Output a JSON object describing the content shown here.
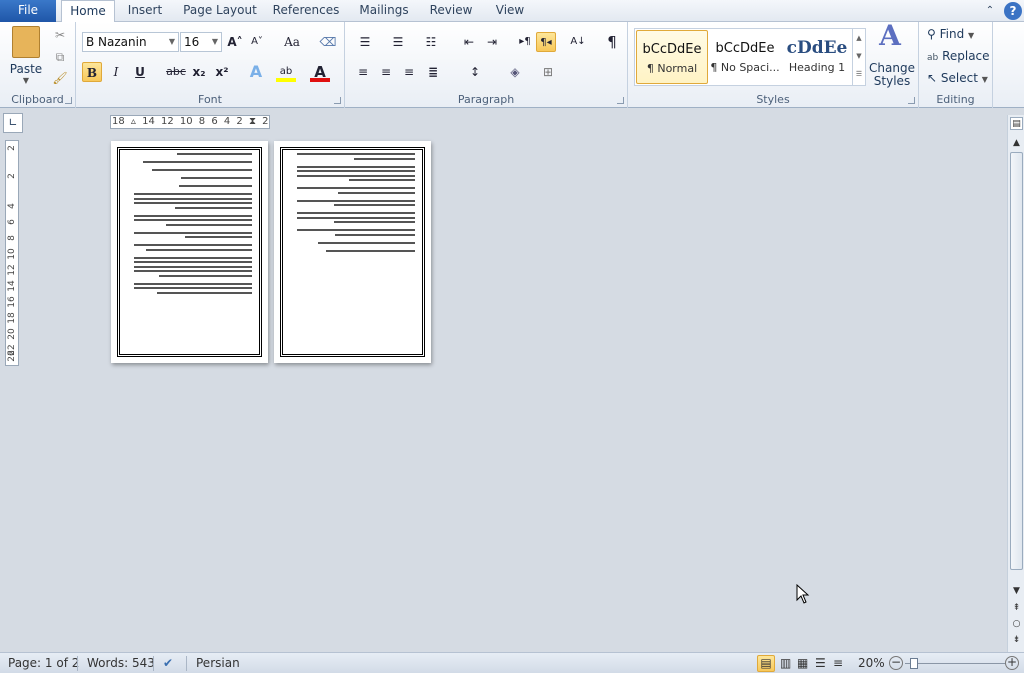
{
  "tabs": [
    "File",
    "Home",
    "Insert",
    "Page Layout",
    "References",
    "Mailings",
    "Review",
    "View"
  ],
  "active_tab": "Home",
  "clipboard": {
    "paste": "Paste",
    "label": "Clipboard"
  },
  "font": {
    "name": "B Nazanin",
    "size": "16",
    "label": "Font",
    "bold": "B",
    "italic": "I",
    "underline": "U",
    "strike": "abc",
    "sub": "x₂",
    "sup": "x²",
    "grow": "A˄",
    "shrink": "A˅",
    "case": "Aa",
    "highlight_color": "#ffff00",
    "font_color": "#e01010"
  },
  "paragraph": {
    "label": "Paragraph",
    "pilcrow": "¶",
    "rtl": "¶◂",
    "ltr": "▸¶"
  },
  "styles": {
    "label": "Styles",
    "items": [
      {
        "preview": "bCcDdEe",
        "name": "¶ Normal",
        "selected": true
      },
      {
        "preview": "bCcDdEe",
        "name": "¶ No Spaci..."
      },
      {
        "preview": "cDdEe",
        "name": "Heading 1"
      }
    ],
    "change": "Change Styles"
  },
  "editing": {
    "label": "Editing",
    "find": "Find",
    "replace": "Replace",
    "select": "Select"
  },
  "ruler": {
    "h": "18 ▵ 14 12 10 8 6 4 2 ⧗ 2",
    "v": [
      "2",
      "2",
      "4",
      "6",
      "8",
      "10",
      "12",
      "14",
      "16",
      "18",
      "20",
      "22",
      "26"
    ]
  },
  "status": {
    "page": "Page: 1 of 2",
    "words": "Words: 543",
    "language": "Persian",
    "zoom": "20%",
    "zoom_percent": 20
  }
}
